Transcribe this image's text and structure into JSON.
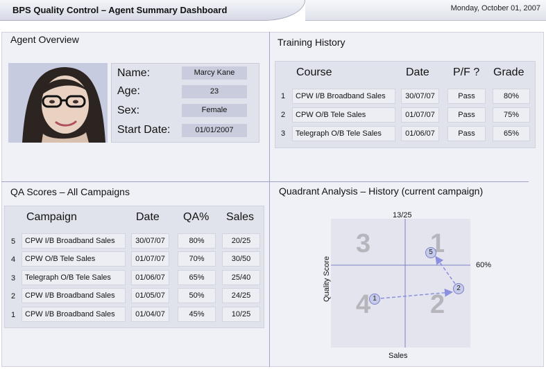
{
  "header": {
    "title": "BPS Quality Control – Agent Summary Dashboard",
    "date": "Monday, October 01, 2007"
  },
  "agent_overview": {
    "title": "Agent Overview",
    "labels": {
      "name": "Name:",
      "age": "Age:",
      "sex": "Sex:",
      "start_date": "Start Date:"
    },
    "values": {
      "name": "Marcy Kane",
      "age": "23",
      "sex": "Female",
      "start_date": "01/01/2007"
    }
  },
  "training_history": {
    "title": "Training History",
    "headers": {
      "course": "Course",
      "date": "Date",
      "pf": "P/F ?",
      "grade": "Grade"
    },
    "rows": [
      {
        "num": "1",
        "course": "CPW I/B Broadband Sales",
        "date": "30/07/07",
        "pf": "Pass",
        "grade": "80%"
      },
      {
        "num": "2",
        "course": "CPW O/B Tele Sales",
        "date": "01/07/07",
        "pf": "Pass",
        "grade": "75%"
      },
      {
        "num": "3",
        "course": "Telegraph O/B Tele Sales",
        "date": "01/06/07",
        "pf": "Pass",
        "grade": "65%"
      }
    ]
  },
  "qa_scores": {
    "title": "QA Scores – All Campaigns",
    "headers": {
      "campaign": "Campaign",
      "date": "Date",
      "qa": "QA%",
      "sales": "Sales"
    },
    "rows": [
      {
        "num": "5",
        "campaign": "CPW I/B Broadband Sales",
        "date": "30/07/07",
        "qa": "80%",
        "sales": "20/25"
      },
      {
        "num": "4",
        "campaign": "CPW O/B Tele Sales",
        "date": "01/07/07",
        "qa": "70%",
        "sales": "30/50"
      },
      {
        "num": "3",
        "campaign": "Telegraph O/B Tele Sales",
        "date": "01/06/07",
        "qa": "65%",
        "sales": "25/40"
      },
      {
        "num": "2",
        "campaign": "CPW I/B Broadband Sales",
        "date": "01/05/07",
        "qa": "50%",
        "sales": "24/25"
      },
      {
        "num": "1",
        "campaign": "CPW I/B Broadband Sales",
        "date": "01/04/07",
        "qa": "45%",
        "sales": "10/25"
      }
    ]
  },
  "quadrant": {
    "title": "Quadrant Analysis – History (current campaign)",
    "top_label": "13/25",
    "right_label": "60%",
    "x_axis": "Sales",
    "y_axis": "Quality Score",
    "quadrants": [
      "1",
      "2",
      "3",
      "4"
    ],
    "points": [
      "1",
      "2",
      "5"
    ],
    "colors": {
      "axis": "#7d81c7",
      "point_fill": "#c7cbea",
      "arrow": "#8a8fe0"
    }
  }
}
